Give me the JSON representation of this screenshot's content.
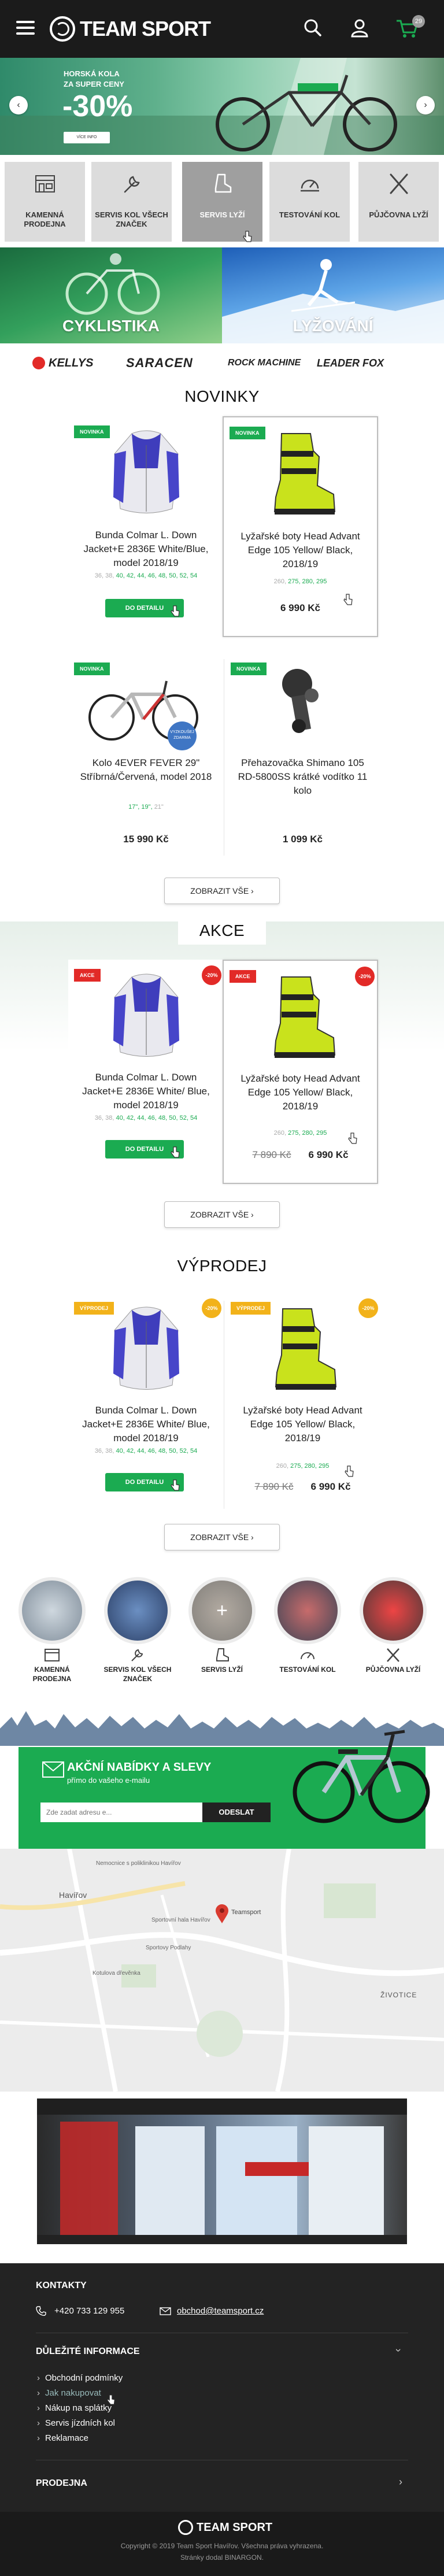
{
  "header": {
    "brand": "TEAM SPORT",
    "cart_count": "29"
  },
  "hero": {
    "line1": "HORSKÁ KOLA",
    "line2": "ZA SUPER CENY",
    "discount": "-30%",
    "button": "VÍCE INFO"
  },
  "categories": [
    {
      "label": "KAMENNÁ PRODEJNA",
      "icon": "storefront-icon"
    },
    {
      "label": "SERVIS KOL VŠECH ZNAČEK",
      "icon": "wrench-icon"
    },
    {
      "label": "SERVIS LYŽÍ",
      "icon": "ski-boot-icon"
    },
    {
      "label": "TESTOVÁNÍ KOL",
      "icon": "speedometer-icon"
    },
    {
      "label": "PŮJČOVNA LYŽÍ",
      "icon": "crossed-skis-icon"
    }
  ],
  "sports": [
    {
      "label": "CYKLISTIKA"
    },
    {
      "label": "LYŽOVÁNÍ"
    }
  ],
  "brands": [
    "KELLYS",
    "SARACEN",
    "ROCK MACHINE",
    "LEADER FOX"
  ],
  "sections": {
    "novinky": "NOVINKY",
    "akce": "AKCE",
    "vyprodej": "VÝPRODEJ",
    "show_all": "ZOBRAZIT VŠE"
  },
  "novinky": [
    {
      "badge": "NOVINKA",
      "name": "Bunda Colmar L. Down Jacket+E 2836E White/Blue, model 2018/19",
      "sizes_gray": "36, 38,",
      "sizes_green": "40, 42, 44, 46, 48, 50, 52, 54",
      "button": "DO DETAILU"
    },
    {
      "badge": "NOVINKA",
      "name": "Lyžařské boty Head Advant Edge 105 Yellow/ Black, 2018/19",
      "sizes_gray": "260,",
      "sizes_green": "275, 280, 295",
      "price": "6 990 Kč"
    },
    {
      "badge": "NOVINKA",
      "name": "Kolo 4EVER FEVER 29\" Stříbrná/Červená, model 2018",
      "sizes_green": "17\", 19\",",
      "sizes_gray": "21\"",
      "price": "15 990 Kč",
      "promo": "VYZKOUŠEJ ZDARMA"
    },
    {
      "badge": "NOVINKA",
      "name": "Přehazovačka Shimano 105 RD-5800SS krátké vodítko 11 kolo",
      "price": "1 099 Kč"
    }
  ],
  "akce": [
    {
      "badge": "AKCE",
      "discount": "-20%",
      "name": "Bunda Colmar L. Down Jacket+E 2836E White/ Blue, model 2018/19",
      "sizes_gray": "36, 38,",
      "sizes_green": "40, 42, 44, 46, 48, 50, 52, 54",
      "button": "DO DETAILU"
    },
    {
      "badge": "AKCE",
      "discount": "-20%",
      "name": "Lyžařské boty Head Advant Edge 105 Yellow/ Black, 2018/19",
      "sizes_gray": "260,",
      "sizes_green": "275, 280, 295",
      "old_price": "7 890 Kč",
      "price": "6 990 Kč"
    }
  ],
  "vyprodej": [
    {
      "badge": "VÝPRODEJ",
      "discount": "-20%",
      "name": "Bunda Colmar L. Down Jacket+E 2836E White/ Blue, model 2018/19",
      "sizes_gray": "36, 38,",
      "sizes_green": "40, 42, 44, 46, 48, 50, 52, 54",
      "button": "DO DETAILU"
    },
    {
      "badge": "VÝPRODEJ",
      "discount": "-20%",
      "name": "Lyžařské boty Head Advant Edge 105 Yellow/ Black, 2018/19",
      "sizes_gray": "260,",
      "sizes_green": "275, 280, 295",
      "old_price": "7 890 Kč",
      "price": "6 990 Kč"
    }
  ],
  "services": [
    {
      "label": "KAMENNÁ PRODEJNA"
    },
    {
      "label": "SERVIS KOL VŠECH ZNAČEK"
    },
    {
      "label": "SERVIS LYŽÍ"
    },
    {
      "label": "TESTOVÁNÍ KOL"
    },
    {
      "label": "PŮJČOVNA LYŽÍ"
    }
  ],
  "newsletter": {
    "title": "AKČNÍ NABÍDKY A SLEVY",
    "subtitle": "přímo do vašeho e-mailu",
    "placeholder": "Zde zadat adresu e...",
    "button": "ODESLAT"
  },
  "map": {
    "city": "Havířov",
    "place": "Teamsport",
    "labels": [
      "Sportovní hala Havířov",
      "Nemocnice s poliklinikou Havířov",
      "Sportovy Podlahy",
      "Kotulova dřevěnka",
      "ŽIVOTICE",
      "Havířov"
    ]
  },
  "footer": {
    "contacts_title": "KONTAKTY",
    "phone": "+420 733 129 955",
    "email": "obchod@teamsport.cz",
    "info_title": "DŮLEŽITÉ INFORMACE",
    "links": [
      "Obchodní podmínky",
      "Jak nakupovat",
      "Nákup na splátky",
      "Servis jízdních kol",
      "Reklamace"
    ],
    "store_title": "PRODEJNA",
    "brand": "TEAM SPORT",
    "copyright": "Copyright © 2019 Team Sport Havířov. Všechna práva vyhrazena.",
    "made_by": "Stránky dodal BINARGON."
  },
  "colors": {
    "green": "#1bab51",
    "red": "#e22a27",
    "yellow": "#f2b21a",
    "dark": "#1b1b1b"
  }
}
